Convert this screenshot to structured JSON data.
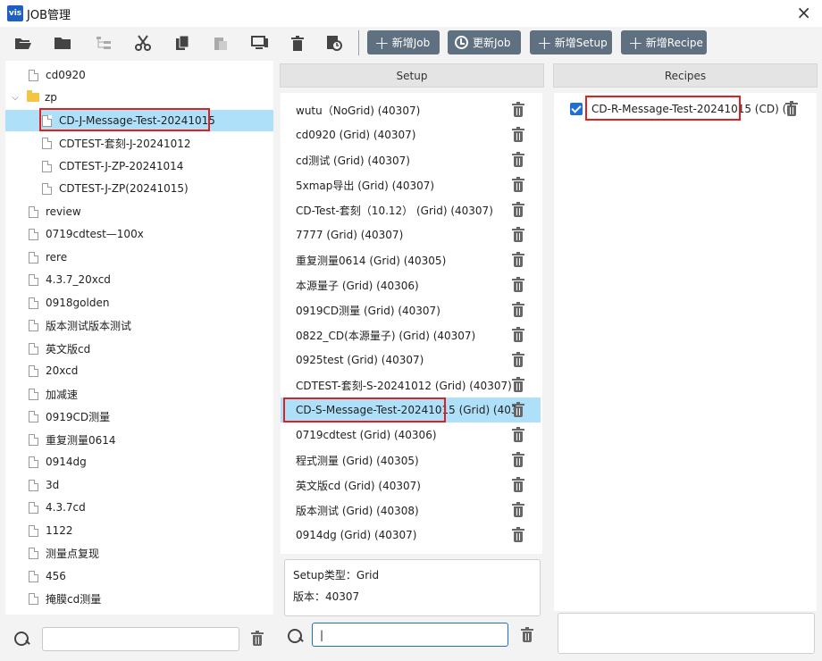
{
  "window": {
    "title": "JOB管理",
    "logo_text": "vis"
  },
  "toolbar": {
    "buttons": [
      {
        "label": "新增Job",
        "icon": "plus-icon"
      },
      {
        "label": "更新Job",
        "icon": "clock-icon"
      },
      {
        "label": "新增Setup",
        "icon": "plus-icon"
      },
      {
        "label": "新增Recipe",
        "icon": "plus-icon"
      }
    ],
    "icons": [
      "open-folder-icon",
      "folder-icon",
      "tree-structure-icon",
      "scissors-icon",
      "copy-icon",
      "paste-icon",
      "monitor-icon",
      "trash-icon",
      "history-icon"
    ]
  },
  "jobs": {
    "items": [
      {
        "label": "cd0920",
        "level": 0,
        "type": "file"
      },
      {
        "label": "zp",
        "level": 0,
        "type": "folder",
        "expanded": true
      },
      {
        "label": "CD-J-Message-Test-20241015",
        "level": 1,
        "type": "file",
        "selected": true
      },
      {
        "label": "CDTEST-套刻-J-20241012",
        "level": 1,
        "type": "file"
      },
      {
        "label": "CDTEST-J-ZP-20241014",
        "level": 1,
        "type": "file"
      },
      {
        "label": "CDTEST-J-ZP(20241015)",
        "level": 1,
        "type": "file"
      },
      {
        "label": "review",
        "level": 0,
        "type": "file"
      },
      {
        "label": "0719cdtest—100x",
        "level": 0,
        "type": "file"
      },
      {
        "label": "rere",
        "level": 0,
        "type": "file"
      },
      {
        "label": "4.3.7_20xcd",
        "level": 0,
        "type": "file"
      },
      {
        "label": "0918golden",
        "level": 0,
        "type": "file"
      },
      {
        "label": "版本测试版本测试",
        "level": 0,
        "type": "file"
      },
      {
        "label": "英文版cd",
        "level": 0,
        "type": "file"
      },
      {
        "label": "20xcd",
        "level": 0,
        "type": "file"
      },
      {
        "label": "加减速",
        "level": 0,
        "type": "file"
      },
      {
        "label": "0919CD测量",
        "level": 0,
        "type": "file"
      },
      {
        "label": "重复测量0614",
        "level": 0,
        "type": "file"
      },
      {
        "label": "0914dg",
        "level": 0,
        "type": "file"
      },
      {
        "label": "3d",
        "level": 0,
        "type": "file"
      },
      {
        "label": "4.3.7cd",
        "level": 0,
        "type": "file"
      },
      {
        "label": "1122",
        "level": 0,
        "type": "file"
      },
      {
        "label": "测量点复现",
        "level": 0,
        "type": "file"
      },
      {
        "label": "456",
        "level": 0,
        "type": "file"
      },
      {
        "label": "掩膜cd测量",
        "level": 0,
        "type": "file"
      }
    ],
    "search_value": ""
  },
  "setup": {
    "header": "Setup",
    "items": [
      {
        "label": "wutu（NoGrid) (40307)"
      },
      {
        "label": "cd0920 (Grid) (40307)"
      },
      {
        "label": "cd测试 (Grid) (40307)"
      },
      {
        "label": "5xmap导出 (Grid) (40307)"
      },
      {
        "label": "CD-Test-套刻（10.12） (Grid) (40307)"
      },
      {
        "label": "7777 (Grid) (40307)"
      },
      {
        "label": "重复测量0614 (Grid) (40305)"
      },
      {
        "label": "本源量子 (Grid) (40306)"
      },
      {
        "label": "0919CD测量 (Grid) (40307)"
      },
      {
        "label": "0822_CD(本源量子) (Grid) (40307)"
      },
      {
        "label": "0925test (Grid) (40307)"
      },
      {
        "label": "CDTEST-套刻-S-20241012 (Grid) (40307)"
      },
      {
        "label": "CD-S-Message-Test-20241015 (Grid) (403",
        "selected": true
      },
      {
        "label": "0719cdtest (Grid) (40306)"
      },
      {
        "label": "程式测量 (Grid) (40305)"
      },
      {
        "label": "英文版cd (Grid) (40307)"
      },
      {
        "label": "版本测试 (Grid) (40308)"
      },
      {
        "label": "0914dg (Grid) (40307)"
      }
    ],
    "info": {
      "type_line": "Setup类型：Grid",
      "version_line": "版本：40307"
    },
    "search_value": "|"
  },
  "recipes": {
    "header": "Recipes",
    "items": [
      {
        "label": "CD-R-Message-Test-20241015 (CD) (4",
        "checked": true
      }
    ]
  },
  "colors": {
    "accent": "#1e6fd6",
    "selection": "#aee0f9",
    "toolbar_button": "#5f7080",
    "highlight": "#e0201e"
  }
}
